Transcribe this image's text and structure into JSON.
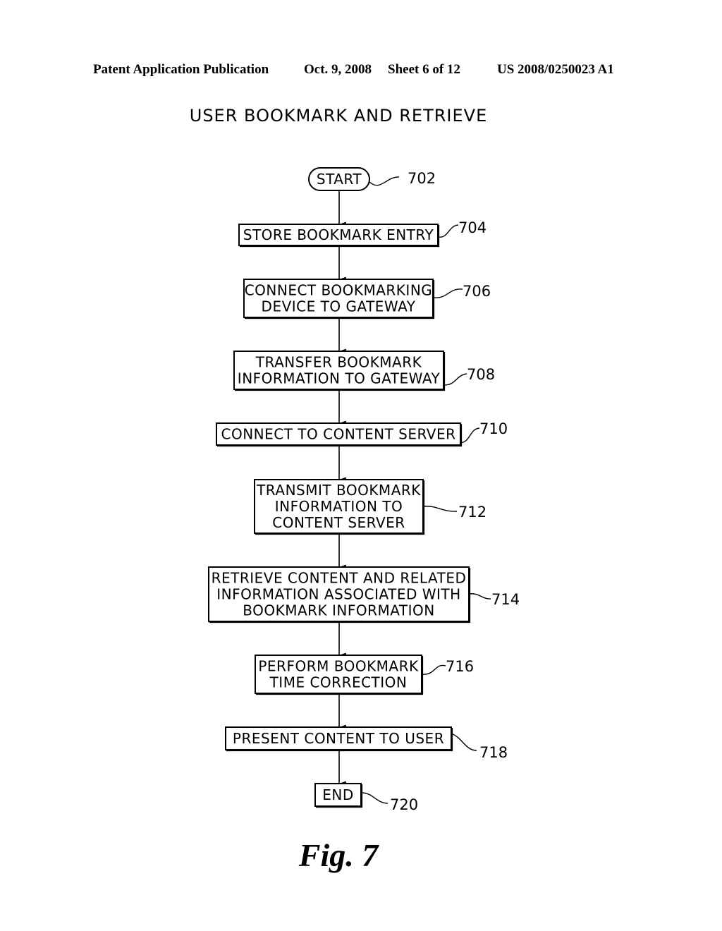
{
  "header": {
    "publication": "Patent Application Publication",
    "date": "Oct. 9, 2008",
    "sheet": "Sheet 6 of 12",
    "number": "US 2008/0250023 A1"
  },
  "diagram": {
    "title": "USER BOOKMARK AND RETRIEVE",
    "figure_label": "Fig. 7",
    "steps": [
      {
        "id": "702",
        "shape": "terminator",
        "lines": [
          "START"
        ]
      },
      {
        "id": "704",
        "shape": "process",
        "lines": [
          "STORE BOOKMARK ENTRY"
        ]
      },
      {
        "id": "706",
        "shape": "process",
        "lines": [
          "CONNECT BOOKMARKING",
          "DEVICE TO GATEWAY"
        ]
      },
      {
        "id": "708",
        "shape": "process",
        "lines": [
          "TRANSFER BOOKMARK",
          "INFORMATION TO GATEWAY"
        ]
      },
      {
        "id": "710",
        "shape": "process",
        "lines": [
          "CONNECT TO CONTENT SERVER"
        ]
      },
      {
        "id": "712",
        "shape": "process",
        "lines": [
          "TRANSMIT BOOKMARK",
          "INFORMATION TO",
          "CONTENT SERVER"
        ]
      },
      {
        "id": "714",
        "shape": "process",
        "lines": [
          "RETRIEVE CONTENT AND RELATED",
          "INFORMATION ASSOCIATED WITH",
          "BOOKMARK INFORMATION"
        ]
      },
      {
        "id": "716",
        "shape": "process",
        "lines": [
          "PERFORM BOOKMARK",
          "TIME CORRECTION"
        ]
      },
      {
        "id": "718",
        "shape": "process",
        "lines": [
          "PRESENT CONTENT TO USER"
        ]
      },
      {
        "id": "720",
        "shape": "process",
        "lines": [
          "END"
        ]
      }
    ],
    "edges": [
      [
        "702",
        "704"
      ],
      [
        "704",
        "706"
      ],
      [
        "706",
        "708"
      ],
      [
        "708",
        "710"
      ],
      [
        "710",
        "712"
      ],
      [
        "712",
        "714"
      ],
      [
        "714",
        "716"
      ],
      [
        "716",
        "718"
      ],
      [
        "718",
        "720"
      ]
    ]
  }
}
